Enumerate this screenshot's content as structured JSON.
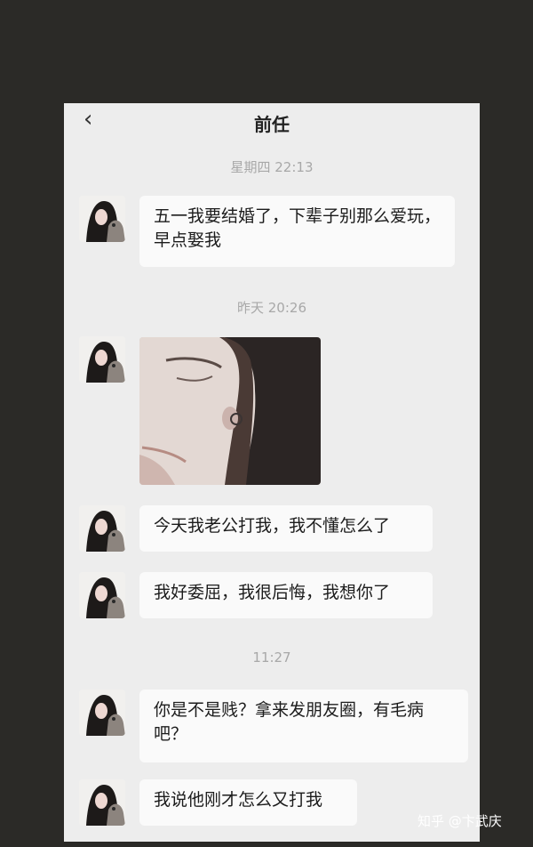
{
  "chat": {
    "title": "前任",
    "back_icon": "chevron-left-icon",
    "timestamps": [
      "星期四 22:13",
      "昨天 20:26",
      "11:27"
    ],
    "messages": [
      {
        "text": "五一我要结婚了，下辈子别那么爱玩，早点娶我"
      },
      {
        "type": "image",
        "description": ""
      },
      {
        "text": "今天我老公打我，我不懂怎么了"
      },
      {
        "text": "我好委屈，我很后悔，我想你了"
      },
      {
        "text": "你是不是贱？拿来发朋友圈，有毛病吧？"
      },
      {
        "text": "我说他刚才怎么又打我"
      }
    ]
  },
  "watermark": {
    "text": "知乎 @卞武庆"
  }
}
